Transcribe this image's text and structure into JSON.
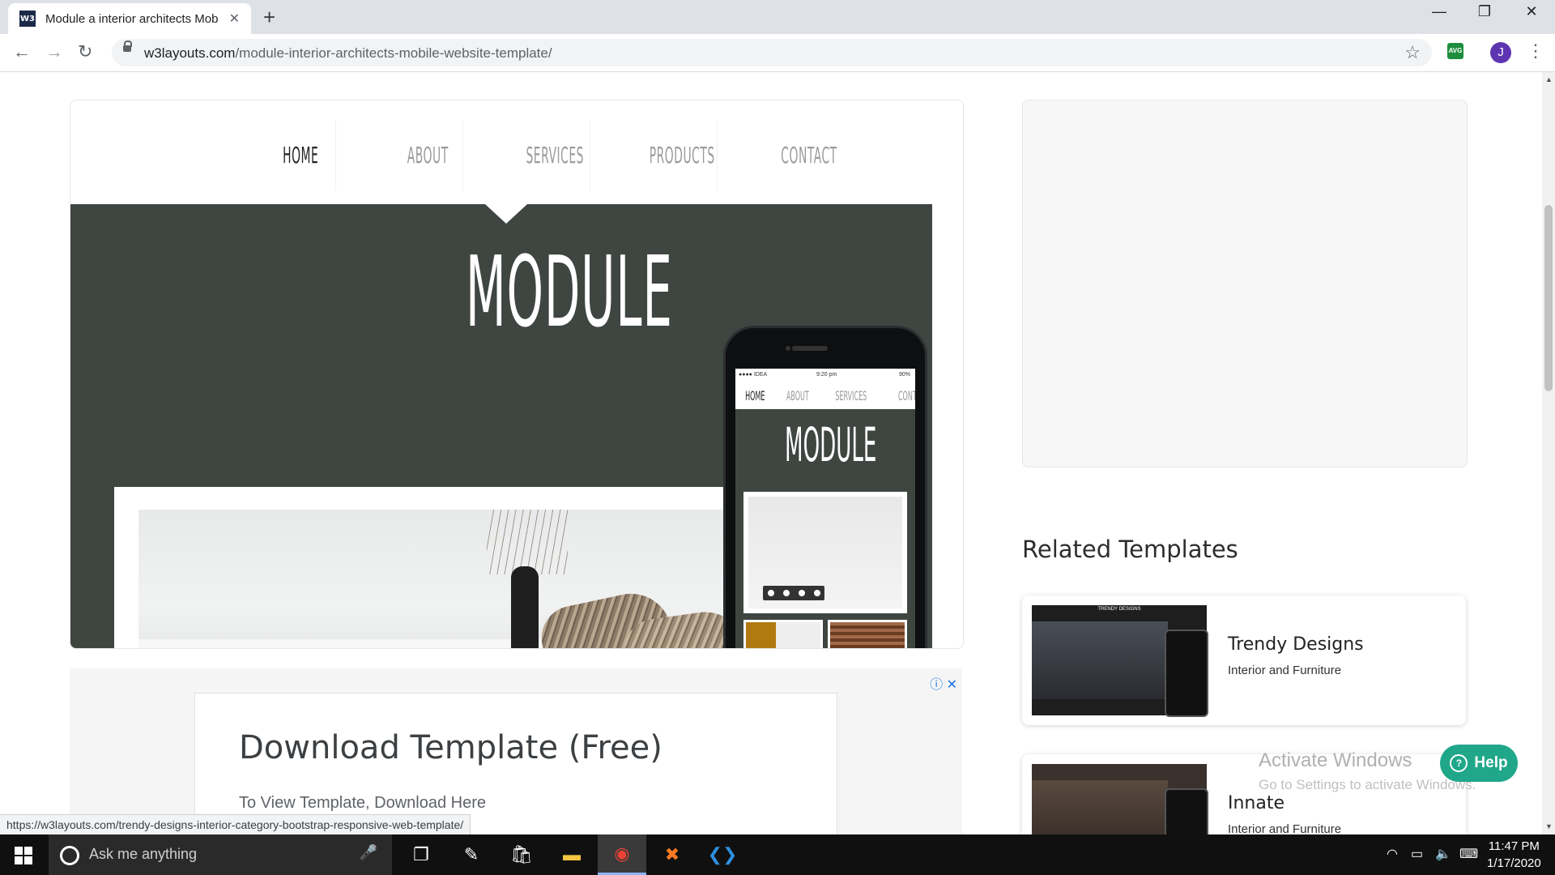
{
  "browser": {
    "tab_title": "Module a interior architects Mob",
    "tab_favicon": "W3",
    "url_host": "w3layouts.com",
    "url_path": "/module-interior-architects-mobile-website-template/",
    "avatar_letter": "J",
    "extension_label": "AVG"
  },
  "preview": {
    "nav": [
      "HOME",
      "ABOUT",
      "SERVICES",
      "PRODUCTS",
      "CONTACT"
    ],
    "hero_title": "MODULE",
    "phone": {
      "carrier": "●●●● IDEA",
      "time": "9:20 pm",
      "battery": "90%",
      "nav": [
        "HOME",
        "ABOUT",
        "SERVICES",
        "CONTACT"
      ],
      "title": "MODULE"
    }
  },
  "ad": {
    "title": "Download Template (Free)",
    "subtitle": "To View Template, Download Here"
  },
  "related": {
    "heading": "Related Templates",
    "items": [
      {
        "name": "Trendy Designs",
        "category": "Interior and Furniture",
        "thumb_brand": "TRENDY DESIGNS"
      },
      {
        "name": "Innate",
        "category": "Interior and Furniture"
      }
    ]
  },
  "help_button": "Help",
  "watermark": {
    "title": "Activate Windows",
    "subtitle": "Go to Settings to activate Windows."
  },
  "status_url": "https://w3layouts.com/trendy-designs-interior-category-bootstrap-responsive-web-template/",
  "taskbar": {
    "search_placeholder": "Ask me anything",
    "time": "11:47 PM",
    "date": "1/17/2020"
  },
  "colors": {
    "hero_bg": "#3f4641",
    "help_bg": "#20a78a",
    "avatar_bg": "#5e35b1"
  }
}
